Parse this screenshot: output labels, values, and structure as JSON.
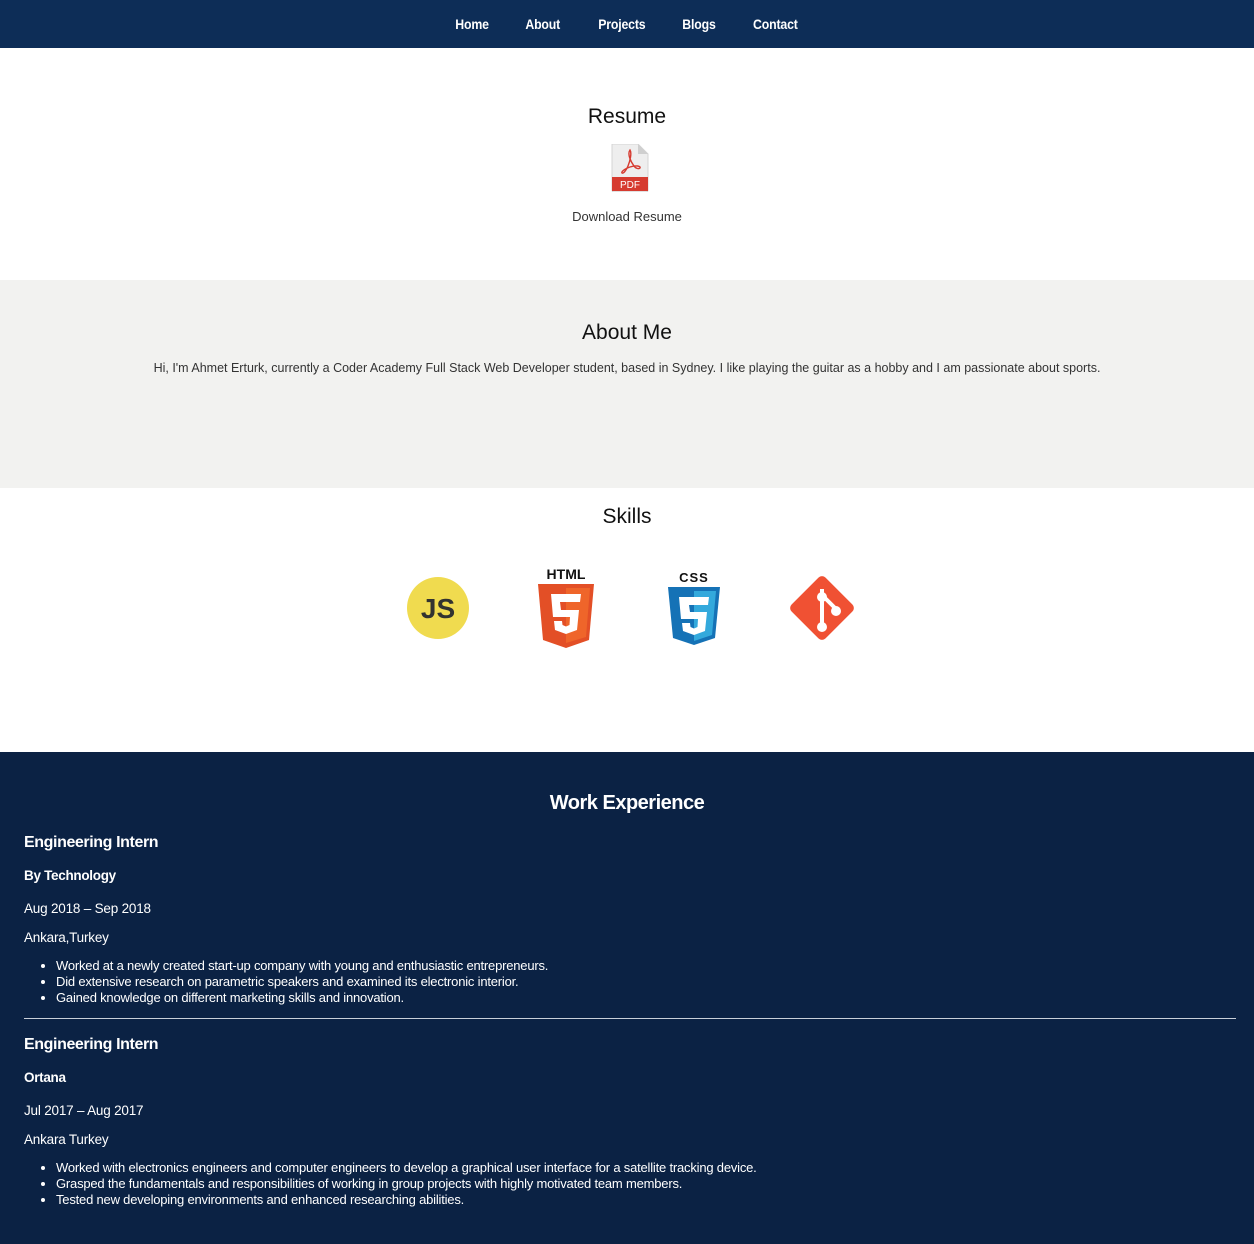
{
  "nav": {
    "items": [
      "Home",
      "About",
      "Projects",
      "Blogs",
      "Contact"
    ]
  },
  "resume": {
    "heading": "Resume",
    "icon": "pdf-icon",
    "pdf_label": "PDF",
    "download_label": "Download Resume"
  },
  "about": {
    "heading": "About Me",
    "text": "Hi, I'm Ahmet Erturk, currently a Coder Academy Full Stack Web Developer student, based in Sydney. I like playing the guitar as a hobby and I am passionate about sports."
  },
  "skills": {
    "heading": "Skills",
    "items": [
      {
        "name": "javascript-icon",
        "label": "JS",
        "color": "#f0db4f"
      },
      {
        "name": "html5-icon",
        "label": "HTML",
        "color": "#e34f26"
      },
      {
        "name": "css3-icon",
        "label": "CSS",
        "color": "#1572b6"
      },
      {
        "name": "git-icon",
        "label": "",
        "color": "#f05133"
      }
    ]
  },
  "work": {
    "heading": "Work Experience",
    "jobs": [
      {
        "title": "Engineering Intern",
        "company": "By Technology",
        "dates": "Aug 2018 – Sep 2018",
        "location": "Ankara,Turkey",
        "bullets": [
          "Worked at a newly created start-up company with young and enthusiastic entrepreneurs.",
          "Did extensive research on parametric speakers and examined its electronic interior.",
          "Gained knowledge on different marketing skills and innovation."
        ]
      },
      {
        "title": "Engineering Intern",
        "company": "Ortana",
        "dates": "Jul 2017 – Aug 2017",
        "location": "Ankara Turkey",
        "bullets": [
          "Worked with electronics engineers and computer engineers to develop a graphical user interface for a satellite tracking device.",
          "Grasped the fundamentals and responsibilities of working in group projects with highly motivated team members.",
          "Tested new developing environments and enhanced researching abilities."
        ]
      }
    ]
  },
  "colors": {
    "nav_bg": "#0d2d57",
    "about_bg": "#f2f2f0",
    "work_bg": "#0b2244"
  }
}
